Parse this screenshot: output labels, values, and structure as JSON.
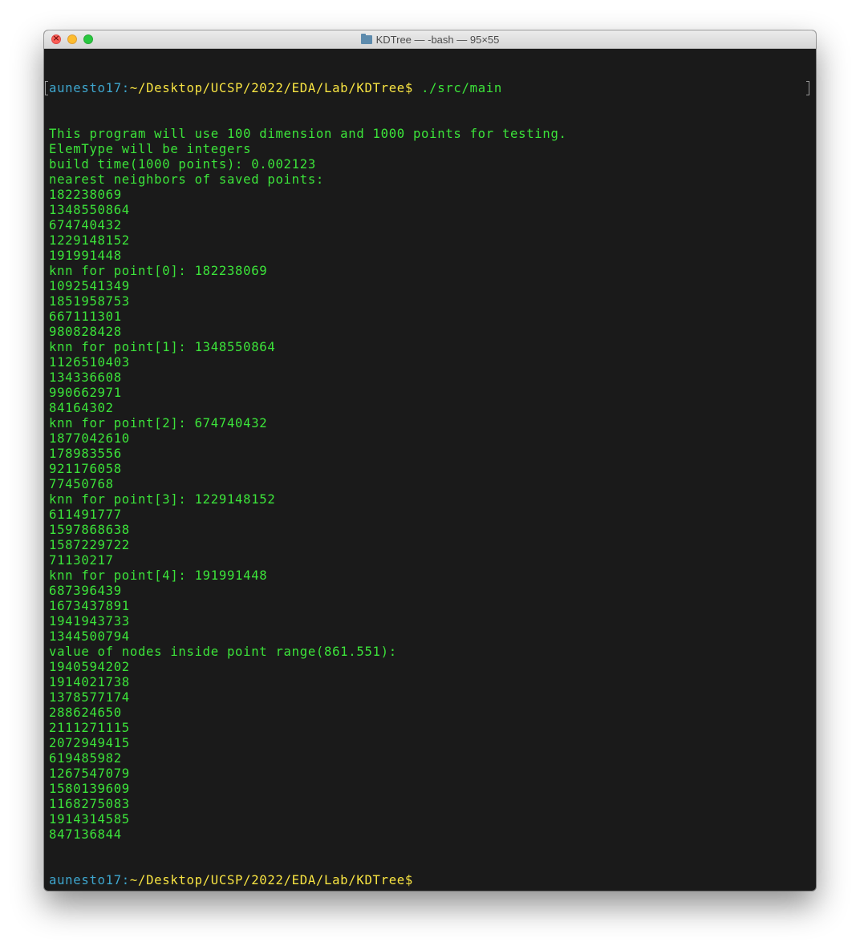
{
  "window": {
    "title": "KDTree — -bash — 95×55",
    "folder_icon": "folder-icon"
  },
  "prompt": {
    "user": "aunesto17",
    "separator": ":",
    "path": "~/Desktop/UCSP/2022/EDA/Lab/KDTree",
    "symbol": "$",
    "command": " ./src/main"
  },
  "output": [
    "This program will use 100 dimension and 1000 points for testing.",
    "ElemType will be integers",
    "build time(1000 points): 0.002123",
    "nearest neighbors of saved points:",
    "182238069",
    "1348550864",
    "674740432",
    "1229148152",
    "191991448",
    "knn for point[0]: 182238069",
    "1092541349",
    "1851958753",
    "667111301",
    "980828428",
    "knn for point[1]: 1348550864",
    "1126510403",
    "134336608",
    "990662971",
    "84164302",
    "knn for point[2]: 674740432",
    "1877042610",
    "178983556",
    "921176058",
    "77450768",
    "knn for point[3]: 1229148152",
    "611491777",
    "1597868638",
    "1587229722",
    "71130217",
    "knn for point[4]: 191991448",
    "687396439",
    "1673437891",
    "1941943733",
    "1344500794",
    "value of nodes inside point range(861.551):",
    "1940594202",
    "1914021738",
    "1378577174",
    "288624650",
    "2111271115",
    "2072949415",
    "619485982",
    "1267547079",
    "1580139609",
    "1168275083",
    "1914314585",
    "847136844"
  ],
  "final_prompt": {
    "user": "aunesto17",
    "separator": ":",
    "path": "~/Desktop/UCSP/2022/EDA/Lab/KDTree",
    "symbol": "$"
  },
  "colors": {
    "background": "#1a1a1a",
    "output_text": "#3ce43a",
    "user": "#3ea6ce",
    "path": "#f7e342"
  }
}
